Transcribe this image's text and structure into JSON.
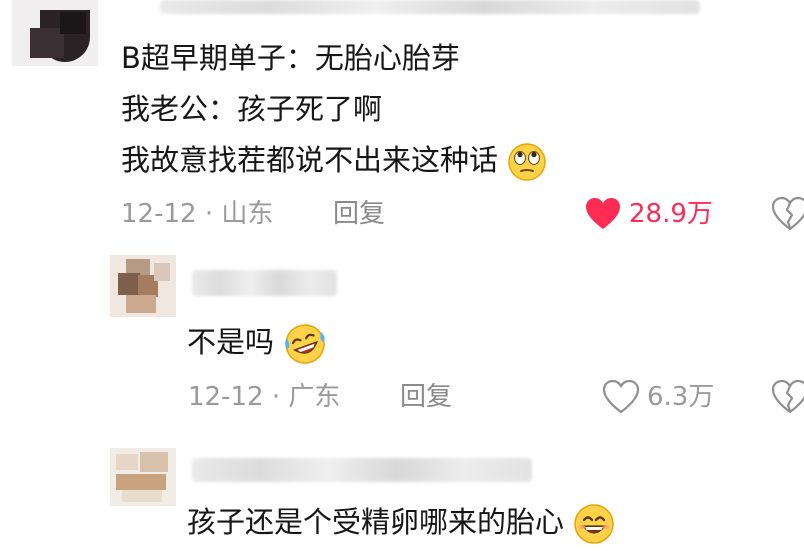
{
  "comments": [
    {
      "lines": [
        "B超早期单子：无胎心胎芽",
        "我老公：孩子死了啊",
        "我故意找茬都说不出来这种话"
      ],
      "emoji": "eye-roll-emoji",
      "date": "12-12",
      "location": "山东",
      "reply_label": "回复",
      "likes": "28.9万",
      "liked": true
    },
    {
      "lines": [
        "不是吗"
      ],
      "emoji": "laughing-crying-emoji",
      "date": "12-12",
      "location": "广东",
      "reply_label": "回复",
      "likes": "6.3万",
      "liked": false
    },
    {
      "lines": [
        "孩子还是个受精卵哪来的胎心"
      ],
      "emoji": "grinning-emoji"
    }
  ],
  "colors": {
    "liked": "#fe2c55",
    "meta": "#9a9a9a",
    "text": "#161616"
  },
  "icons": [
    "heart-icon",
    "dislike-heart-icon"
  ]
}
